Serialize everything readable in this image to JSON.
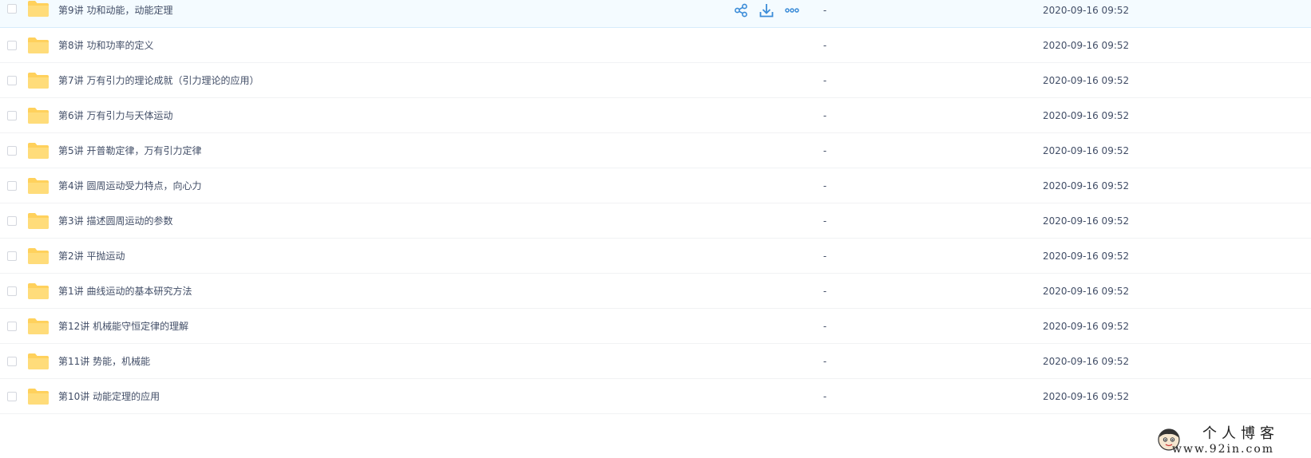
{
  "file_list": {
    "rows": [
      {
        "name": "第9讲 功和动能，动能定理",
        "size": "-",
        "date": "2020-09-16 09:52"
      },
      {
        "name": "第8讲 功和功率的定义",
        "size": "-",
        "date": "2020-09-16 09:52"
      },
      {
        "name": "第7讲 万有引力的理论成就（引力理论的应用）",
        "size": "-",
        "date": "2020-09-16 09:52"
      },
      {
        "name": "第6讲 万有引力与天体运动",
        "size": "-",
        "date": "2020-09-16 09:52"
      },
      {
        "name": "第5讲 开普勒定律，万有引力定律",
        "size": "-",
        "date": "2020-09-16 09:52"
      },
      {
        "name": "第4讲 圆周运动受力特点，向心力",
        "size": "-",
        "date": "2020-09-16 09:52"
      },
      {
        "name": "第3讲 描述圆周运动的参数",
        "size": "-",
        "date": "2020-09-16 09:52"
      },
      {
        "name": "第2讲 平抛运动",
        "size": "-",
        "date": "2020-09-16 09:52"
      },
      {
        "name": "第1讲 曲线运动的基本研究方法",
        "size": "-",
        "date": "2020-09-16 09:52"
      },
      {
        "name": "第12讲 机械能守恒定律的理解",
        "size": "-",
        "date": "2020-09-16 09:52"
      },
      {
        "name": "第11讲 势能，机械能",
        "size": "-",
        "date": "2020-09-16 09:52"
      },
      {
        "name": "第10讲 动能定理的应用",
        "size": "-",
        "date": "2020-09-16 09:52"
      }
    ],
    "hovered_row_index": 0,
    "row_actions": [
      "share-icon",
      "download-icon",
      "more-icon"
    ],
    "folder_icon": "folder-icon",
    "colors": {
      "folder": "#ffd15c",
      "action": "#3b8cd8",
      "hover_bg": "#f4fbff"
    }
  },
  "watermark": {
    "title": "个人博客",
    "url": "www.92in.com",
    "avatar_icon": "cartoon-avatar-icon"
  }
}
